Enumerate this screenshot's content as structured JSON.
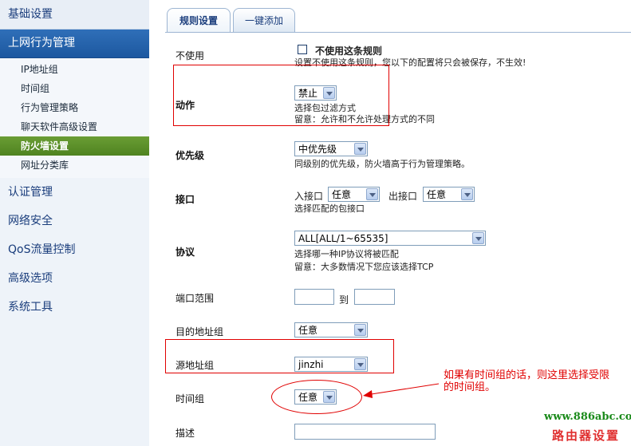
{
  "sidebar": {
    "top_item": "基础设置",
    "main_item": "上网行为管理",
    "sub_items": [
      "IP地址组",
      "时间组",
      "行为管理策略",
      "聊天软件高级设置",
      "防火墙设置",
      "网址分类库"
    ],
    "active_sub_index": 4,
    "items": [
      "认证管理",
      "网络安全",
      "QoS流量控制",
      "高级选项",
      "系统工具"
    ]
  },
  "tabs": [
    "规则设置",
    "一键添加"
  ],
  "form": {
    "disable": {
      "label": "不使用",
      "checkbox_label": "不使用这条规则",
      "checked": false,
      "hint": "设置不使用这条规则，您以下的配置将只会被保存，不生效!"
    },
    "action": {
      "label": "动作",
      "value": "禁止",
      "hint1": "选择包过滤方式",
      "hint2": "留意：允许和不允许处理方式的不同"
    },
    "priority": {
      "label": "优先级",
      "value": "中优先级",
      "hint": "同级别的优先级，防火墙高于行为管理策略。"
    },
    "interface": {
      "label": "接口",
      "in_label": "入接口",
      "in_value": "任意",
      "out_label": "出接口",
      "out_value": "任意",
      "hint": "选择匹配的包接口"
    },
    "protocol": {
      "label": "协议",
      "value": "ALL[ALL/1~65535]",
      "hint1": "选择哪一种IP协议将被匹配",
      "hint2": "留意：大多数情况下您应该选择TCP"
    },
    "port_range": {
      "label": "端口范围",
      "to": "到",
      "from_value": "",
      "to_value": ""
    },
    "dest_group": {
      "label": "目的地址组",
      "value": "任意"
    },
    "src_group": {
      "label": "源地址组",
      "value": "jinzhi"
    },
    "time_group": {
      "label": "时间组",
      "value": "任意"
    },
    "description": {
      "label": "描述",
      "value": ""
    }
  },
  "annotation": {
    "note_line1": "如果有时间组的话，则这里选择受限",
    "note_line2": "的时间组。",
    "color": "#e00000"
  },
  "watermark": {
    "url": "www.886abc.com",
    "name": "路由器设置"
  }
}
